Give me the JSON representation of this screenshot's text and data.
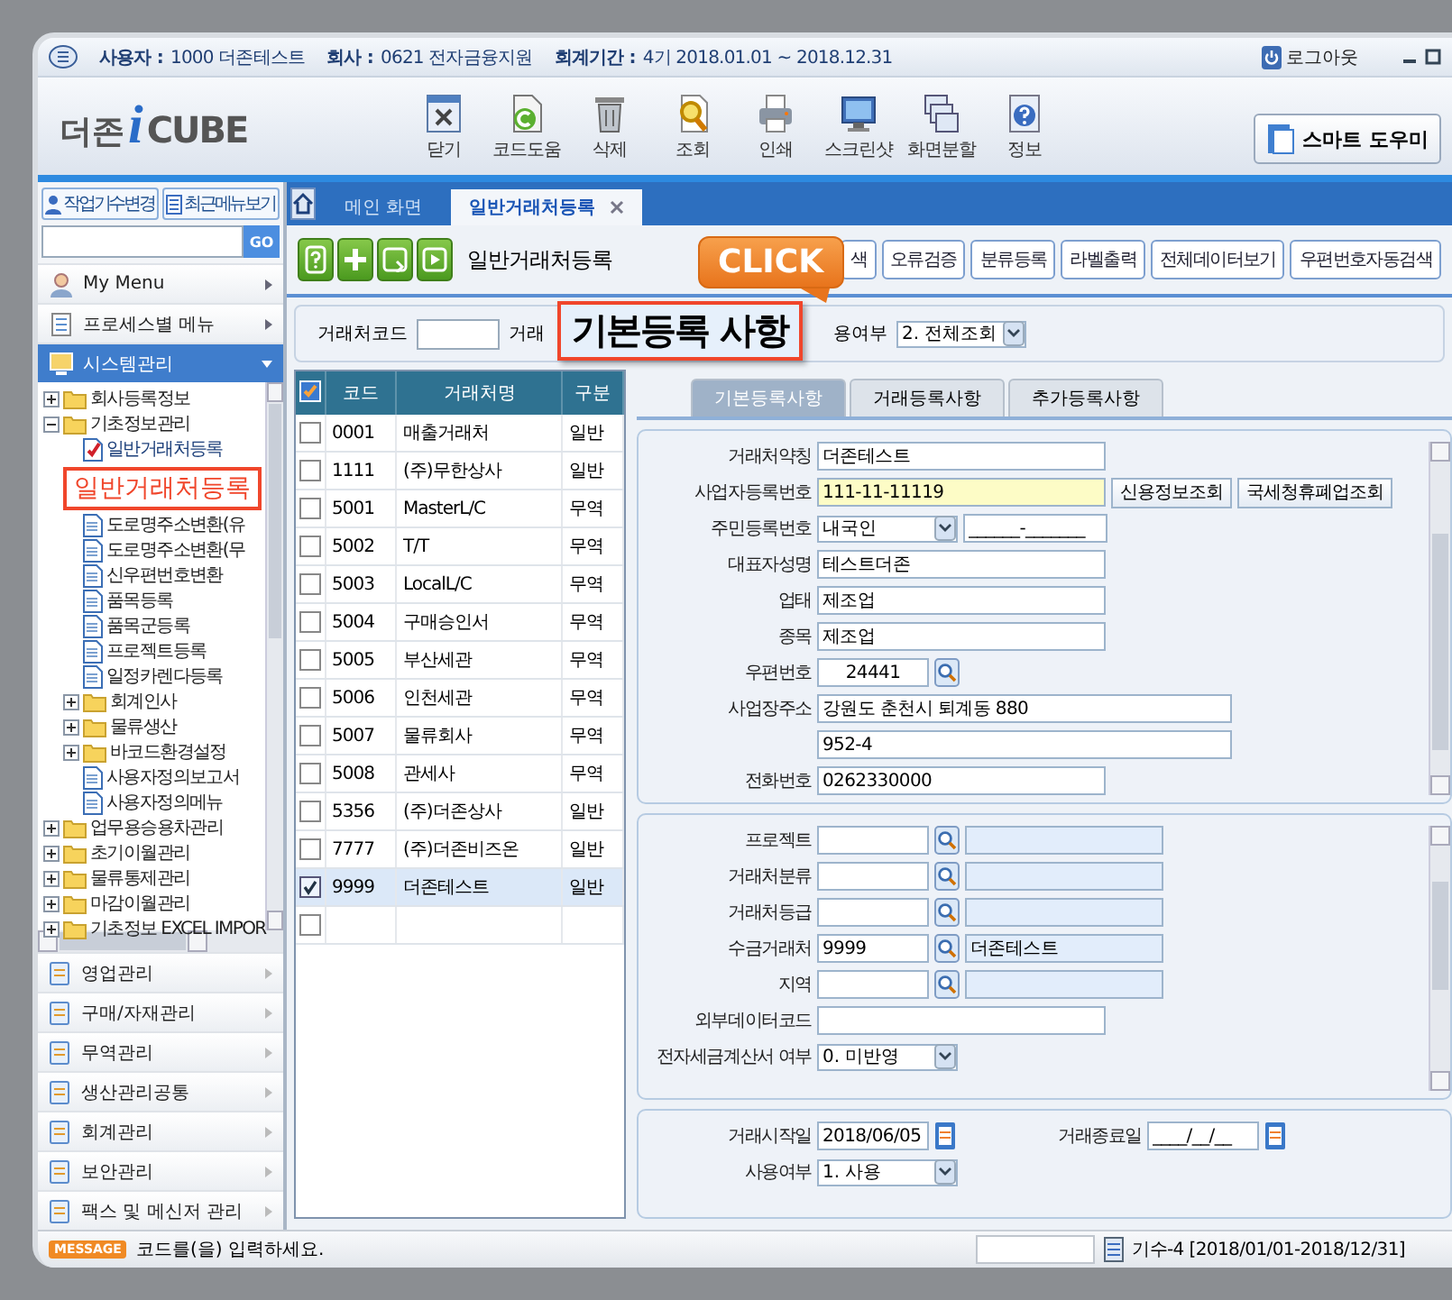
{
  "top_bar": {
    "items": [
      {
        "label": "사용자 :",
        "value": "1000 더존테스트"
      },
      {
        "label": "회사 :",
        "value": "0621 전자금융지원"
      },
      {
        "label": "회계기간 :",
        "value": "4기 2018.01.01 ~ 2018.12.31"
      }
    ],
    "logout": "로그아웃"
  },
  "logo": {
    "text": "더존",
    "mark": "i",
    "brand": "CUBE"
  },
  "toolbar": [
    {
      "label": "닫기",
      "kind": "close"
    },
    {
      "label": "코드도움",
      "kind": "help"
    },
    {
      "label": "삭제",
      "kind": "delete"
    },
    {
      "label": "조회",
      "kind": "search"
    },
    {
      "label": "인쇄",
      "kind": "print"
    },
    {
      "label": "스크린샷",
      "kind": "capture"
    },
    {
      "label": "화면분할",
      "kind": "split"
    },
    {
      "label": "정보",
      "kind": "info"
    }
  ],
  "helper_button": "스마트 도우미",
  "sidebar": {
    "buttons": [
      "작업기수변경",
      "최근메뉴보기"
    ],
    "search": {
      "button": "GO"
    },
    "menus": [
      {
        "label": "My Menu",
        "kind": "person",
        "selected": false
      },
      {
        "label": "프로세스별 메뉴",
        "kind": "list",
        "selected": false
      },
      {
        "label": "시스템관리",
        "kind": "system",
        "selected": true
      }
    ],
    "tree": [
      {
        "label": "회사등록정보",
        "kind": "folder",
        "expanded": false,
        "selected": false
      },
      {
        "label": "기초정보관리",
        "kind": "folder",
        "expanded": true,
        "selected": false,
        "children": [
          {
            "label": "일반거래처등록",
            "kind": "page",
            "selected": true
          },
          {
            "label": "도로명주소변환(유",
            "kind": "page",
            "selected": false
          },
          {
            "label": "도로명주소변환(무",
            "kind": "page",
            "selected": false
          },
          {
            "label": "신우편번호변환",
            "kind": "page",
            "selected": false
          },
          {
            "label": "품목등록",
            "kind": "page",
            "selected": false
          },
          {
            "label": "품목군등록",
            "kind": "page",
            "selected": false
          },
          {
            "label": "프로젝트등록",
            "kind": "page",
            "selected": false
          },
          {
            "label": "일정카렌다등록",
            "kind": "page",
            "selected": false
          },
          {
            "label": "회계인사",
            "kind": "folder",
            "expanded": false,
            "selected": false
          },
          {
            "label": "물류생산",
            "kind": "folder",
            "expanded": false,
            "selected": false
          },
          {
            "label": "바코드환경설정",
            "kind": "folder",
            "expanded": false,
            "selected": false
          },
          {
            "label": "사용자정의보고서",
            "kind": "page",
            "selected": false
          },
          {
            "label": "사용자정의메뉴",
            "kind": "page",
            "selected": false
          }
        ]
      },
      {
        "label": "업무용승용차관리",
        "kind": "folder",
        "expanded": false,
        "selected": false
      },
      {
        "label": "초기이월관리",
        "kind": "folder",
        "expanded": false,
        "selected": false
      },
      {
        "label": "물류통제관리",
        "kind": "folder",
        "expanded": false,
        "selected": false
      },
      {
        "label": "마감이월관리",
        "kind": "folder",
        "expanded": false,
        "selected": false
      },
      {
        "label": "기초정보 EXCEL IMPOR",
        "kind": "folder",
        "expanded": false,
        "selected": false
      }
    ],
    "modules": [
      "영업관리",
      "구매/자재관리",
      "무역관리",
      "생산관리공통",
      "회계관리",
      "보안관리",
      "팩스 및 메신저 관리"
    ]
  },
  "callouts": {
    "click": "CLICK",
    "section": "기본등록 사항",
    "menu": "일반거래처등록"
  },
  "tabs": [
    {
      "label": "메인 화면",
      "selected": false,
      "closable": false
    },
    {
      "label": "일반거래처등록",
      "selected": true,
      "closable": true
    }
  ],
  "title": "일반거래처등록",
  "actions": [
    "색",
    "오류검증",
    "분류등록",
    "라벨출력",
    "전체데이터보기",
    "우편번호자동검색"
  ],
  "filter": {
    "code_label": "거래처코드",
    "name_label": "거래",
    "use_label": "용여부",
    "use_value": "2. 전체조회"
  },
  "grid": {
    "columns": [
      "코드",
      "거래처명",
      "구분"
    ],
    "rows": [
      {
        "code": "0001",
        "name": "매출거래처",
        "type": "일반",
        "checked": false,
        "selected": false
      },
      {
        "code": "1111",
        "name": "(주)무한상사",
        "type": "일반",
        "checked": false,
        "selected": false
      },
      {
        "code": "5001",
        "name": "MasterL/C",
        "type": "무역",
        "checked": false,
        "selected": false
      },
      {
        "code": "5002",
        "name": "T/T",
        "type": "무역",
        "checked": false,
        "selected": false
      },
      {
        "code": "5003",
        "name": "LocalL/C",
        "type": "무역",
        "checked": false,
        "selected": false
      },
      {
        "code": "5004",
        "name": "구매승인서",
        "type": "무역",
        "checked": false,
        "selected": false
      },
      {
        "code": "5005",
        "name": "부산세관",
        "type": "무역",
        "checked": false,
        "selected": false
      },
      {
        "code": "5006",
        "name": "인천세관",
        "type": "무역",
        "checked": false,
        "selected": false
      },
      {
        "code": "5007",
        "name": "물류회사",
        "type": "무역",
        "checked": false,
        "selected": false
      },
      {
        "code": "5008",
        "name": "관세사",
        "type": "무역",
        "checked": false,
        "selected": false
      },
      {
        "code": "5356",
        "name": "(주)더존상사",
        "type": "일반",
        "checked": false,
        "selected": false
      },
      {
        "code": "7777",
        "name": "(주)더존비즈온",
        "type": "일반",
        "checked": false,
        "selected": false
      },
      {
        "code": "9999",
        "name": "더존테스트",
        "type": "일반",
        "checked": true,
        "selected": true
      },
      {
        "checked": false,
        "selected": false
      }
    ]
  },
  "detail_tabs": [
    {
      "label": "기본등록사항",
      "selected": true
    },
    {
      "label": "거래등록사항",
      "selected": false
    },
    {
      "label": "추가등록사항",
      "selected": false
    }
  ],
  "basic_form": [
    {
      "kind": "text",
      "label": "거래처약칭",
      "value": "더존테스트"
    },
    {
      "kind": "text",
      "label": "사업자등록번호",
      "value": "111-11-11119",
      "highlighted": true,
      "buttons": [
        "신용정보조회",
        "국세청휴폐업조회"
      ]
    },
    {
      "kind": "select_mask",
      "label": "주민등록번호",
      "value": "내국인",
      "mask": "______-_______"
    },
    {
      "kind": "text",
      "label": "대표자성명",
      "value": "테스트더존"
    },
    {
      "kind": "text",
      "label": "업태",
      "value": "제조업"
    },
    {
      "kind": "text",
      "label": "종목",
      "value": "제조업"
    },
    {
      "kind": "lookup",
      "label": "우편번호",
      "value": "24441"
    },
    {
      "kind": "wide",
      "label": "사업장주소",
      "value": "강원도 춘천시 퇴계동 880"
    },
    {
      "kind": "wide",
      "value": "952-4"
    },
    {
      "kind": "text",
      "label": "전화번호",
      "value": "0262330000"
    }
  ],
  "extra_form": [
    {
      "kind": "code_lookup",
      "label": "프로젝트"
    },
    {
      "kind": "code_lookup",
      "label": "거래처분류"
    },
    {
      "kind": "code_lookup",
      "label": "거래처등급"
    },
    {
      "kind": "code_lookup",
      "label": "수금거래처",
      "value": "9999",
      "name": "더존테스트"
    },
    {
      "kind": "code_lookup",
      "label": "지역"
    },
    {
      "kind": "text",
      "label": "외부데이터코드"
    },
    {
      "kind": "select",
      "label": "전자세금계산서 여부",
      "value": "0. 미반영"
    }
  ],
  "period": {
    "start_label": "거래시작일",
    "start": "2018/06/05",
    "end_label": "거래종료일",
    "end": "____/__/__",
    "use_label": "사용여부",
    "use_value": "1. 사용"
  },
  "status_bar": {
    "badge": "MESSAGE",
    "message": "코드를(을) 입력하세요.",
    "period": "기수-4 [2018/01/01-2018/12/31]"
  }
}
